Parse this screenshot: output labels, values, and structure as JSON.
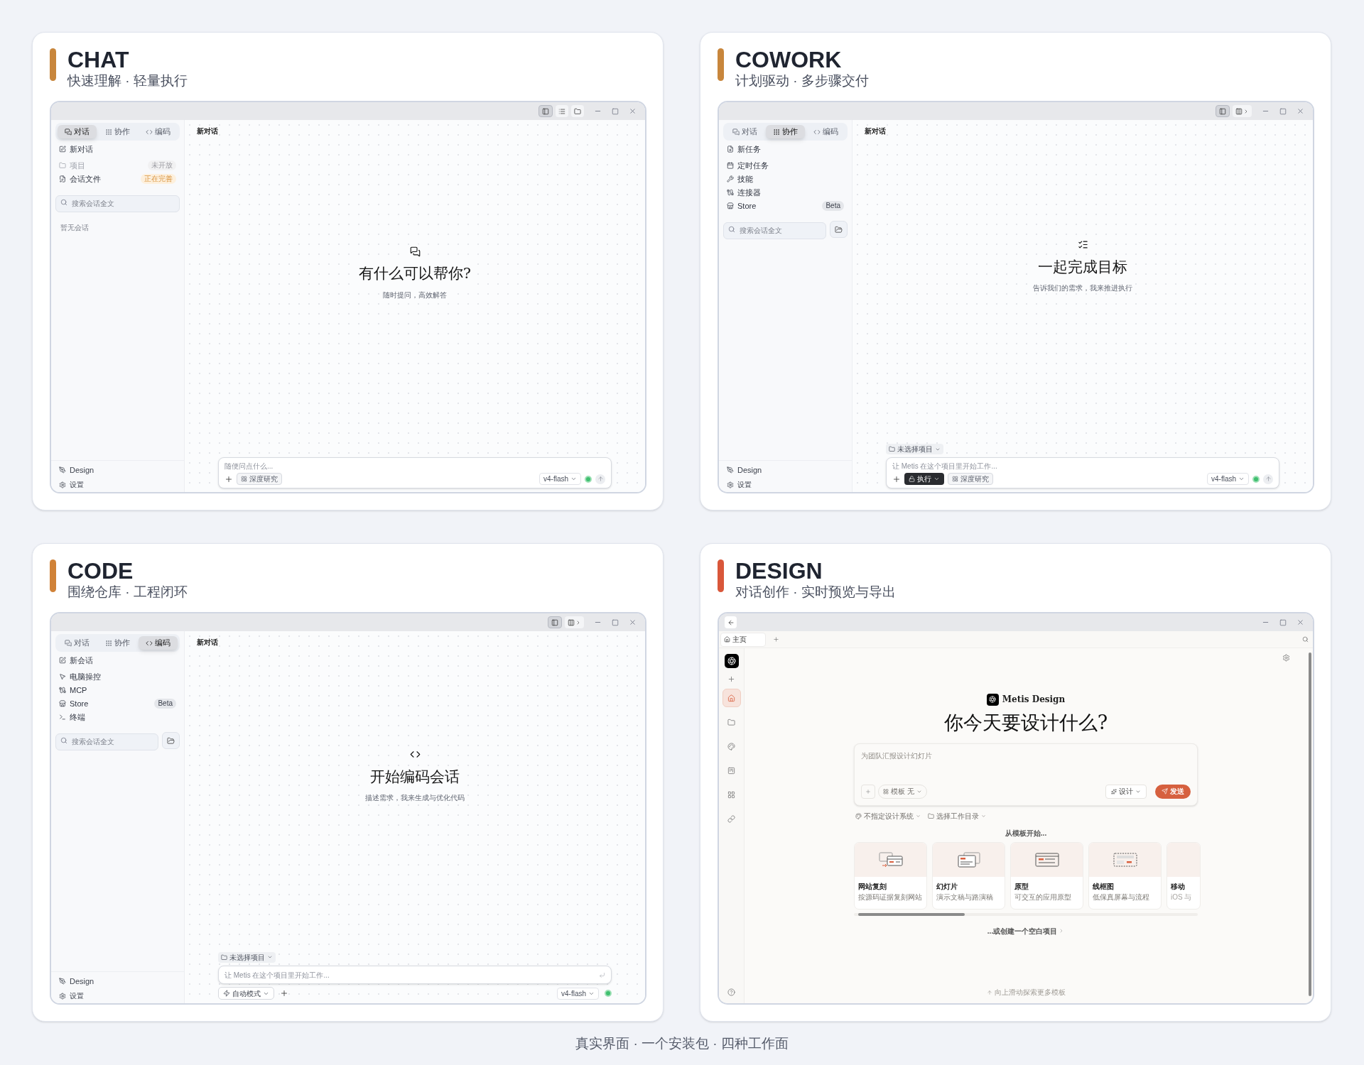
{
  "panels": [
    {
      "kind": "chat",
      "title": "CHAT",
      "subtitle": "快速理解 · 轻量执行",
      "color": "#c8863c",
      "window": {
        "toolbar": [
          {
            "selected": true
          },
          {
            "selected": false
          },
          {
            "selected": false
          }
        ],
        "mode_tabs": [
          {
            "label": "对话",
            "selected": true
          },
          {
            "label": "协作",
            "selected": false
          },
          {
            "label": "编码",
            "selected": false
          }
        ],
        "nav": [
          {
            "label": "新对话",
            "disabled": false
          },
          {
            "label": "项目",
            "disabled": true,
            "badge": {
              "label": "未开放",
              "kind": "muted"
            }
          },
          {
            "label": "会话文件",
            "disabled": false,
            "badge": {
              "label": "正在完善",
              "kind": "warning"
            }
          }
        ],
        "search": {
          "placeholder": "搜索会话全文"
        },
        "empty_text": "暂无会话",
        "footer": [
          "Design",
          "设置"
        ],
        "page_title": "新对话",
        "hero_title": "有什么可以帮你?",
        "hero_subtitle": "随时提问，高效解答",
        "composer": {
          "placeholder": "随便问点什么...",
          "chips": [
            {
              "label": "深度研究",
              "kind": "outline"
            }
          ],
          "model": "v4-flash"
        }
      }
    },
    {
      "kind": "cowork",
      "title": "COWORK",
      "subtitle": "计划驱动 · 多步骤交付",
      "color": "#c8863c",
      "window": {
        "toolbar": [
          {
            "selected": true
          },
          {
            "selected": false
          }
        ],
        "mode_tabs": [
          {
            "label": "对话",
            "selected": false
          },
          {
            "label": "协作",
            "selected": true
          },
          {
            "label": "编码",
            "selected": false
          }
        ],
        "nav": [
          {
            "label": "新任务",
            "disabled": false
          },
          {
            "label": "定时任务",
            "disabled": false
          },
          {
            "label": "技能",
            "disabled": false
          },
          {
            "label": "连接器",
            "disabled": false
          },
          {
            "label": "Store",
            "disabled": false,
            "badge": {
              "label": "Beta",
              "kind": "neutral"
            }
          }
        ],
        "search": {
          "placeholder": "搜索会话全文"
        },
        "open_folder_button": true,
        "footer": [
          "Design",
          "设置"
        ],
        "page_title": "新对话",
        "hero_title": "一起完成目标",
        "hero_subtitle": "告诉我们的需求，我来推进执行",
        "project_chip": "未选择项目",
        "composer": {
          "placeholder": "让 Metis 在这个项目里开始工作...",
          "chips": [
            {
              "label": "执行",
              "kind": "dark"
            },
            {
              "label": "深度研究",
              "kind": "outline"
            }
          ],
          "model": "v4-flash"
        }
      }
    },
    {
      "kind": "code",
      "title": "CODE",
      "subtitle": "围绕仓库 · 工程闭环",
      "color": "#d08238",
      "window": {
        "toolbar": [
          {
            "selected": true
          },
          {
            "selected": false
          }
        ],
        "mode_tabs": [
          {
            "label": "对话",
            "selected": false
          },
          {
            "label": "协作",
            "selected": false
          },
          {
            "label": "编码",
            "selected": true
          }
        ],
        "nav": [
          {
            "label": "新会话",
            "disabled": false
          },
          {
            "label": "电脑操控",
            "disabled": false
          },
          {
            "label": "MCP",
            "disabled": false
          },
          {
            "label": "Store",
            "disabled": false,
            "badge": {
              "label": "Beta",
              "kind": "neutral"
            }
          },
          {
            "label": "终端",
            "disabled": false
          }
        ],
        "search": {
          "placeholder": "搜索会话全文"
        },
        "open_folder_button": true,
        "footer": [
          "Design",
          "设置"
        ],
        "page_title": "新对话",
        "hero_title": "开始编码会话",
        "hero_subtitle": "描述需求，我来生成与优化代码",
        "project_chip": "未选择项目",
        "composer": {
          "placeholder": "让 Metis 在这个项目里开始工作...",
          "chips": [
            {
              "label": "自动模式",
              "kind": "mode"
            }
          ],
          "model": "v4-flash"
        }
      }
    },
    {
      "kind": "design",
      "title": "DESIGN",
      "subtitle": "对话创作 · 实时预览与导出",
      "color": "#d9573a",
      "window": {
        "tab": "主页",
        "rail": [
          {
            "selected": true
          },
          {
            "selected": false
          },
          {
            "selected": false
          },
          {
            "selected": false
          },
          {
            "selected": false
          },
          {
            "selected": false
          }
        ],
        "brand": "Metis Design",
        "heading": "你今天要设计什么?",
        "composer": {
          "placeholder": "为团队汇报设计幻灯片",
          "template": "模板 无",
          "mode": "设计",
          "send": "发送"
        },
        "options": [
          "不指定设计系统",
          "选择工作目录"
        ],
        "section_label": "从模板开始...",
        "templates": [
          {
            "title": "网站复刻",
            "description": "按源码证据复刻网站"
          },
          {
            "title": "幻灯片",
            "description": "演示文稿与路演稿"
          },
          {
            "title": "原型",
            "description": "可交互的应用原型"
          },
          {
            "title": "线框图",
            "description": "低保真屏幕与流程"
          },
          {
            "title": "移动",
            "description": "iOS 与"
          }
        ],
        "blank_link": "...或创建一个空白项目",
        "hint": "向上滑动探索更多模板"
      }
    }
  ],
  "footer": "真实界面 · 一个安装包 · 四种工作面"
}
